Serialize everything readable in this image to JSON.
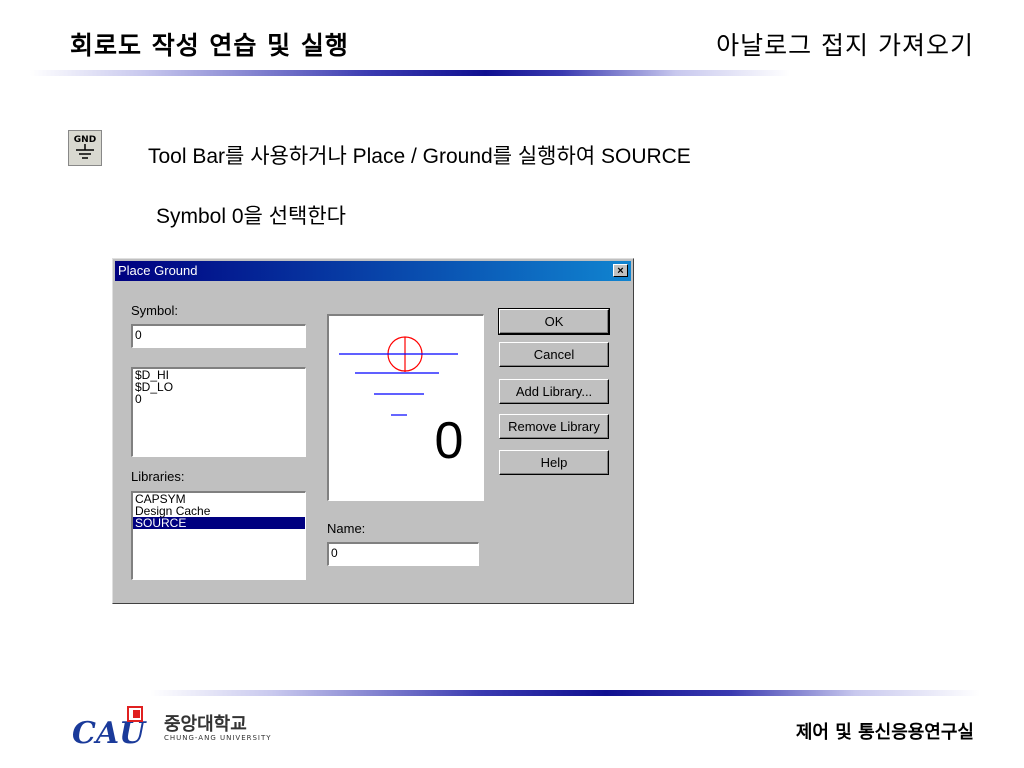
{
  "slide": {
    "title": "회로도 작성 연습 및 실행",
    "subtitle": "아날로그 접지 가져오기",
    "icon_name": "ground-toolbar-icon",
    "icon_label": "GND",
    "line1": "Tool Bar를 사용하거나 Place / Ground를 실행하여 SOURCE",
    "line2": "Symbol 0을 선택한다"
  },
  "dialog": {
    "title": "Place Ground",
    "close_label": "×",
    "symbol_label": "Symbol:",
    "symbol_value": "0",
    "symbol_list": [
      "$D_HI",
      "$D_LO",
      "0"
    ],
    "libraries_label": "Libraries:",
    "libraries": [
      "CAPSYM",
      "Design Cache",
      "SOURCE"
    ],
    "selected_library": "SOURCE",
    "preview_text": "0",
    "name_label": "Name:",
    "name_value": "0",
    "buttons": {
      "ok": "OK",
      "cancel": "Cancel",
      "add_library": "Add Library...",
      "remove_library": "Remove Library",
      "help": "Help"
    }
  },
  "footer": {
    "logo_mark": "CAU",
    "university": "중앙대학교",
    "university_en": "CHUNG-ANG UNIVERSITY",
    "lab": "제어 및 통신응용연구실"
  },
  "colors": {
    "titlebar": "#000080",
    "selection": "#000080",
    "preview_symbol_red": "#ff0000",
    "preview_symbol_blue": "#0000ff",
    "logo_blue": "#1a3a9a",
    "logo_red": "#e02020"
  }
}
